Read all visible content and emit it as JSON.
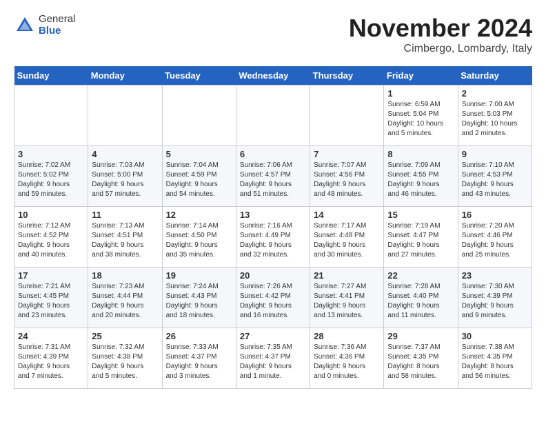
{
  "header": {
    "logo_general": "General",
    "logo_blue": "Blue",
    "month_title": "November 2024",
    "location": "Cimbergo, Lombardy, Italy"
  },
  "weekdays": [
    "Sunday",
    "Monday",
    "Tuesday",
    "Wednesday",
    "Thursday",
    "Friday",
    "Saturday"
  ],
  "weeks": [
    [
      {
        "day": "",
        "info": ""
      },
      {
        "day": "",
        "info": ""
      },
      {
        "day": "",
        "info": ""
      },
      {
        "day": "",
        "info": ""
      },
      {
        "day": "",
        "info": ""
      },
      {
        "day": "1",
        "info": "Sunrise: 6:59 AM\nSunset: 5:04 PM\nDaylight: 10 hours\nand 5 minutes."
      },
      {
        "day": "2",
        "info": "Sunrise: 7:00 AM\nSunset: 5:03 PM\nDaylight: 10 hours\nand 2 minutes."
      }
    ],
    [
      {
        "day": "3",
        "info": "Sunrise: 7:02 AM\nSunset: 5:02 PM\nDaylight: 9 hours\nand 59 minutes."
      },
      {
        "day": "4",
        "info": "Sunrise: 7:03 AM\nSunset: 5:00 PM\nDaylight: 9 hours\nand 57 minutes."
      },
      {
        "day": "5",
        "info": "Sunrise: 7:04 AM\nSunset: 4:59 PM\nDaylight: 9 hours\nand 54 minutes."
      },
      {
        "day": "6",
        "info": "Sunrise: 7:06 AM\nSunset: 4:57 PM\nDaylight: 9 hours\nand 51 minutes."
      },
      {
        "day": "7",
        "info": "Sunrise: 7:07 AM\nSunset: 4:56 PM\nDaylight: 9 hours\nand 48 minutes."
      },
      {
        "day": "8",
        "info": "Sunrise: 7:09 AM\nSunset: 4:55 PM\nDaylight: 9 hours\nand 46 minutes."
      },
      {
        "day": "9",
        "info": "Sunrise: 7:10 AM\nSunset: 4:53 PM\nDaylight: 9 hours\nand 43 minutes."
      }
    ],
    [
      {
        "day": "10",
        "info": "Sunrise: 7:12 AM\nSunset: 4:52 PM\nDaylight: 9 hours\nand 40 minutes."
      },
      {
        "day": "11",
        "info": "Sunrise: 7:13 AM\nSunset: 4:51 PM\nDaylight: 9 hours\nand 38 minutes."
      },
      {
        "day": "12",
        "info": "Sunrise: 7:14 AM\nSunset: 4:50 PM\nDaylight: 9 hours\nand 35 minutes."
      },
      {
        "day": "13",
        "info": "Sunrise: 7:16 AM\nSunset: 4:49 PM\nDaylight: 9 hours\nand 32 minutes."
      },
      {
        "day": "14",
        "info": "Sunrise: 7:17 AM\nSunset: 4:48 PM\nDaylight: 9 hours\nand 30 minutes."
      },
      {
        "day": "15",
        "info": "Sunrise: 7:19 AM\nSunset: 4:47 PM\nDaylight: 9 hours\nand 27 minutes."
      },
      {
        "day": "16",
        "info": "Sunrise: 7:20 AM\nSunset: 4:46 PM\nDaylight: 9 hours\nand 25 minutes."
      }
    ],
    [
      {
        "day": "17",
        "info": "Sunrise: 7:21 AM\nSunset: 4:45 PM\nDaylight: 9 hours\nand 23 minutes."
      },
      {
        "day": "18",
        "info": "Sunrise: 7:23 AM\nSunset: 4:44 PM\nDaylight: 9 hours\nand 20 minutes."
      },
      {
        "day": "19",
        "info": "Sunrise: 7:24 AM\nSunset: 4:43 PM\nDaylight: 9 hours\nand 18 minutes."
      },
      {
        "day": "20",
        "info": "Sunrise: 7:26 AM\nSunset: 4:42 PM\nDaylight: 9 hours\nand 16 minutes."
      },
      {
        "day": "21",
        "info": "Sunrise: 7:27 AM\nSunset: 4:41 PM\nDaylight: 9 hours\nand 13 minutes."
      },
      {
        "day": "22",
        "info": "Sunrise: 7:28 AM\nSunset: 4:40 PM\nDaylight: 9 hours\nand 11 minutes."
      },
      {
        "day": "23",
        "info": "Sunrise: 7:30 AM\nSunset: 4:39 PM\nDaylight: 9 hours\nand 9 minutes."
      }
    ],
    [
      {
        "day": "24",
        "info": "Sunrise: 7:31 AM\nSunset: 4:39 PM\nDaylight: 9 hours\nand 7 minutes."
      },
      {
        "day": "25",
        "info": "Sunrise: 7:32 AM\nSunset: 4:38 PM\nDaylight: 9 hours\nand 5 minutes."
      },
      {
        "day": "26",
        "info": "Sunrise: 7:33 AM\nSunset: 4:37 PM\nDaylight: 9 hours\nand 3 minutes."
      },
      {
        "day": "27",
        "info": "Sunrise: 7:35 AM\nSunset: 4:37 PM\nDaylight: 9 hours\nand 1 minute."
      },
      {
        "day": "28",
        "info": "Sunrise: 7:36 AM\nSunset: 4:36 PM\nDaylight: 9 hours\nand 0 minutes."
      },
      {
        "day": "29",
        "info": "Sunrise: 7:37 AM\nSunset: 4:35 PM\nDaylight: 8 hours\nand 58 minutes."
      },
      {
        "day": "30",
        "info": "Sunrise: 7:38 AM\nSunset: 4:35 PM\nDaylight: 8 hours\nand 56 minutes."
      }
    ]
  ]
}
